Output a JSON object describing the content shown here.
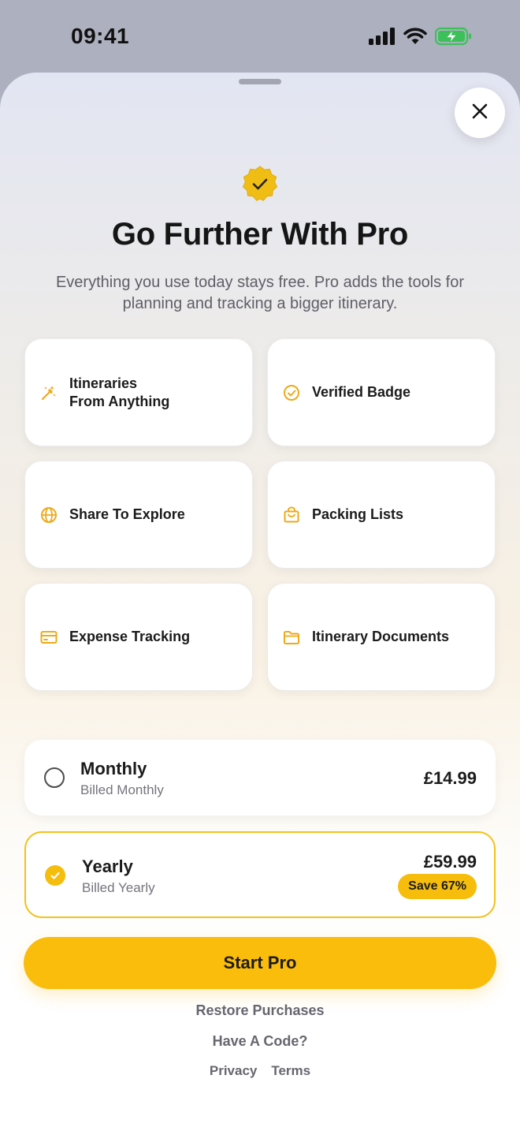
{
  "status_bar": {
    "time": "09:41"
  },
  "colors": {
    "accent": "#FBBD0B",
    "accent_badge": "#F5BD0C",
    "sheet_top": "#E2E5F2"
  },
  "header": {
    "badge_icon": "verified-badge-icon",
    "title": "Go Further With Pro",
    "subtitle": "Everything you use today stays free. Pro adds the tools for planning and tracking a bigger itinerary."
  },
  "features": [
    {
      "icon": "magic-wand-icon",
      "label": "Itineraries\nFrom Anything"
    },
    {
      "icon": "check-circle-icon",
      "label": "Verified Badge"
    },
    {
      "icon": "globe-icon",
      "label": "Share To Explore"
    },
    {
      "icon": "shopping-bag-icon",
      "label": "Packing Lists"
    },
    {
      "icon": "credit-card-icon",
      "label": "Expense Tracking"
    },
    {
      "icon": "folder-icon",
      "label": "Itinerary Documents"
    }
  ],
  "plans": {
    "monthly": {
      "name": "Monthly",
      "billed": "Billed Monthly",
      "price": "£14.99",
      "selected": false
    },
    "yearly": {
      "name": "Yearly",
      "billed": "Billed Yearly",
      "price": "£59.99",
      "badge": "Save 67%",
      "selected": true
    }
  },
  "cta": {
    "label": "Start Pro"
  },
  "links": {
    "restore": "Restore Purchases",
    "code": "Have A Code?",
    "privacy": "Privacy",
    "terms": "Terms"
  }
}
